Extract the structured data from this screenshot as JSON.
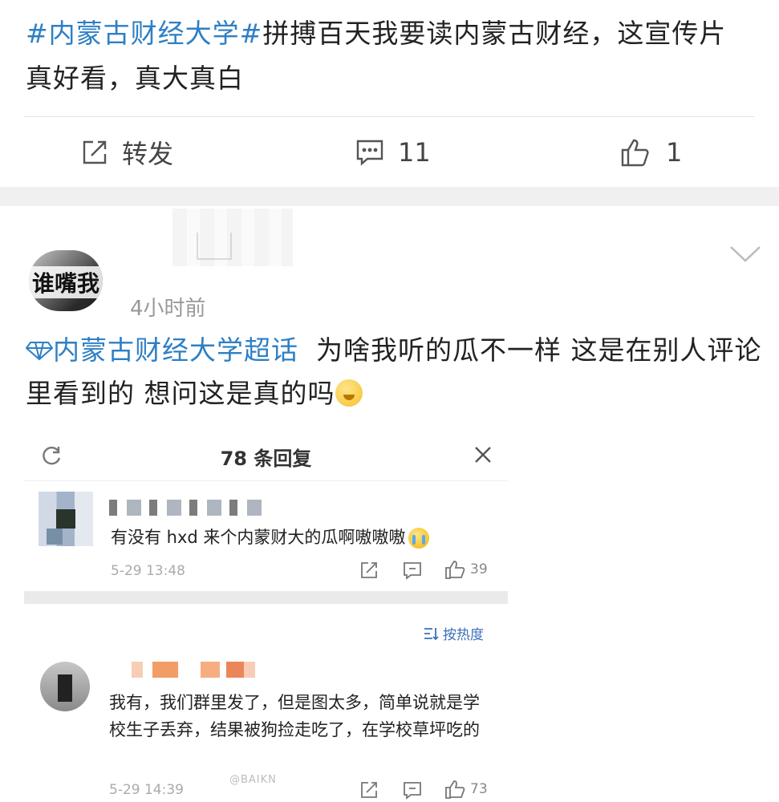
{
  "post1": {
    "topic_tag": "#内蒙古财经大学#",
    "text": "拼搏百天我要读内蒙古财经，这宣传片真好看，真大真白"
  },
  "actions": {
    "repost_label": "转发",
    "comment_count": "11",
    "like_count": "1"
  },
  "post2": {
    "avatar_text": "谁嘴我",
    "time": "4小时前",
    "topic": "内蒙古财经大学超话",
    "text": "为啥我听的瓜不一样 这是在别人评论里看到的 想问这是真的吗"
  },
  "screenshot": {
    "title": "78 条回复",
    "sort_label": "按热度",
    "watermark": "@BAIKN",
    "comments": [
      {
        "text": "有没有 hxd 来个内蒙财大的瓜啊嗷嗷嗷",
        "date": "5-29 13:48",
        "likes": "39"
      },
      {
        "text": "我有，我们群里发了，但是图太多，简单说就是学校生子丢弃，结果被狗捡走吃了，在学校草坪吃的",
        "date": "5-29 14:39",
        "likes": "73"
      }
    ]
  }
}
